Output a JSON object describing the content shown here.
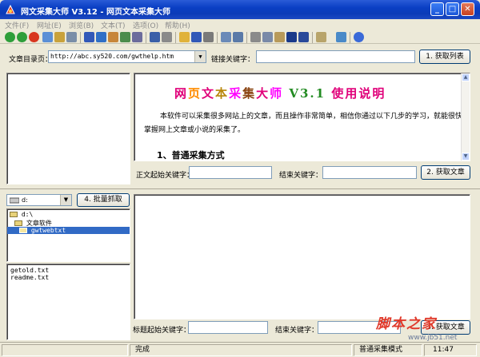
{
  "window": {
    "title": "网文采集大师 V3.12 - 网页文本采集大师",
    "minimize_glyph": "_",
    "maximize_glyph": "□",
    "close_glyph": "✕"
  },
  "menu": [
    "文件(F)",
    "网址(E)",
    "浏览(B)",
    "文本(T)",
    "选项(O)",
    "帮助(H)"
  ],
  "toolbar_icons": [
    "back-icon",
    "forward-icon",
    "stop-icon",
    "refresh-icon",
    "home-icon",
    "search-icon",
    "go-icon",
    "fetch-icon",
    "batch-icon",
    "book-icon",
    "pause-icon",
    "folder-icon",
    "save-icon",
    "print-icon",
    "find-icon",
    "cut-icon",
    "copy-icon",
    "paste-icon",
    "delete-icon",
    "undo-icon",
    "tools-icon",
    "window-icon",
    "help-icon"
  ],
  "url_row": {
    "label": "文章目录页：",
    "url_value": "http://abc.sy520.com/gwthelp.htm",
    "link_label": "链接关键字：",
    "link_value": "",
    "fetch_list_button": "1. 获取列表"
  },
  "doc": {
    "title_chars": [
      {
        "t": "网",
        "c": "#e0007a"
      },
      {
        "t": "页",
        "c": "#ff8c00"
      },
      {
        "t": "文",
        "c": "#e0007a"
      },
      {
        "t": "本",
        "c": "#b8860b"
      },
      {
        "t": "采",
        "c": "#ff00ff"
      },
      {
        "t": "集",
        "c": "#8b4513"
      },
      {
        "t": "大",
        "c": "#e0007a"
      },
      {
        "t": "师",
        "c": "#ff00ff"
      },
      {
        "t": " V3.1 ",
        "c": "#228b22"
      },
      {
        "t": "使",
        "c": "#e0007a"
      },
      {
        "t": "用",
        "c": "#e0007a"
      },
      {
        "t": "说",
        "c": "#e0007a"
      },
      {
        "t": "明",
        "c": "#e0007a"
      }
    ],
    "paragraph": "本软件可以采集很多网站上的文章，而且操作非常简单，相信你通过以下几步的学习，就能很快掌握网上文章或小说的采集了。",
    "heading": "1、普通采集方式"
  },
  "text_keys": {
    "start_label": "正文起始关键字：",
    "end_label": "结束关键字：",
    "get_article_button": "2. 获取文章"
  },
  "drive": {
    "selected": "d:",
    "batch_button": "4. 批量抓取"
  },
  "tree": [
    "d:\\",
    "文章软件",
    "gwtwebtxt"
  ],
  "files": [
    "getold.txt",
    "readme.txt"
  ],
  "title_keys": {
    "start_label": "标题起始关键字：",
    "end_label": "结束关键字：",
    "get_article_button": "3. 获取文章"
  },
  "status": {
    "message": "完成",
    "mode": "普通采集模式",
    "time": "11:47"
  },
  "watermark": {
    "brand": "脚本之家",
    "url": "www.jb51.net"
  }
}
